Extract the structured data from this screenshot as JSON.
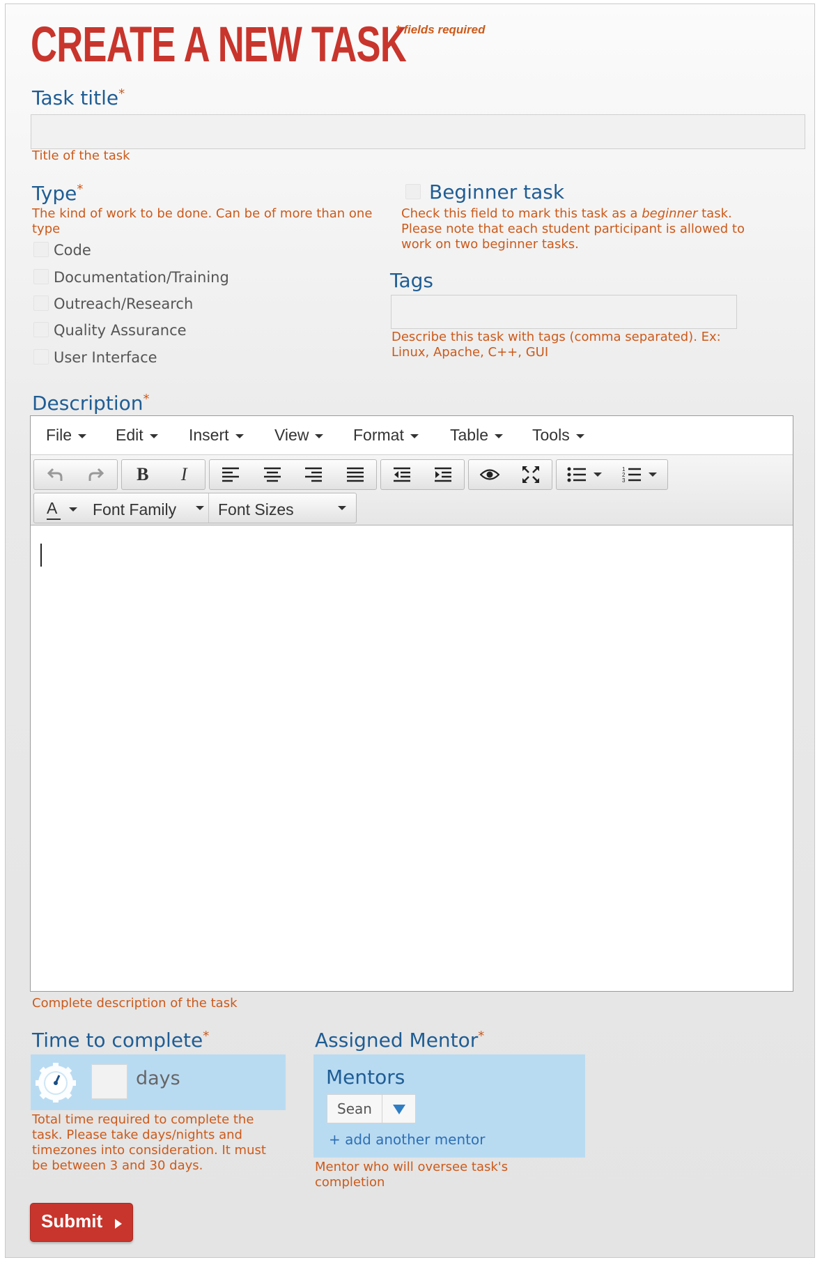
{
  "header": {
    "title": "CREATE A NEW TASK",
    "required_note": "* fields required"
  },
  "task_title": {
    "label": "Task title",
    "required": "*",
    "value": "",
    "help": "Title of the task"
  },
  "type": {
    "label": "Type",
    "required": "*",
    "help": "The kind of work to be done. Can be of more than one type",
    "options": [
      "Code",
      "Documentation/Training",
      "Outreach/Research",
      "Quality Assurance",
      "User Interface"
    ]
  },
  "beginner": {
    "label": "Beginner task",
    "help_prefix": "Check this field to mark this task as a ",
    "help_em": "beginner",
    "help_suffix": " task.",
    "help_line2": "Please note that each student participant is allowed to work on two beginner tasks."
  },
  "tags": {
    "label": "Tags",
    "value": "",
    "help": "Describe this task with tags (comma separated). Ex: Linux, Apache, C++, GUI"
  },
  "description": {
    "label": "Description",
    "required": "*",
    "help": "Complete description of the task",
    "menus": [
      "File",
      "Edit",
      "Insert",
      "View",
      "Format",
      "Table",
      "Tools"
    ],
    "text_color_label": "A",
    "font_family_label": "Font Family",
    "font_sizes_label": "Font Sizes"
  },
  "time": {
    "label": "Time to complete",
    "required": "*",
    "value": "",
    "unit": "days",
    "help": "Total time required to complete the task. Please take days/nights and timezones into consideration. It must be between 3 and 30 days."
  },
  "mentor": {
    "label": "Assigned Mentor",
    "required": "*",
    "panel_title": "Mentors",
    "selected": "Sean",
    "add_link": "+ add another mentor",
    "help": "Mentor who will oversee task's completion"
  },
  "submit_label": "Submit",
  "colors": {
    "accent_red": "#c8352c",
    "help_orange": "#cc5a1a",
    "label_blue": "#1f5d94",
    "panel_blue": "#b9dbf2"
  }
}
